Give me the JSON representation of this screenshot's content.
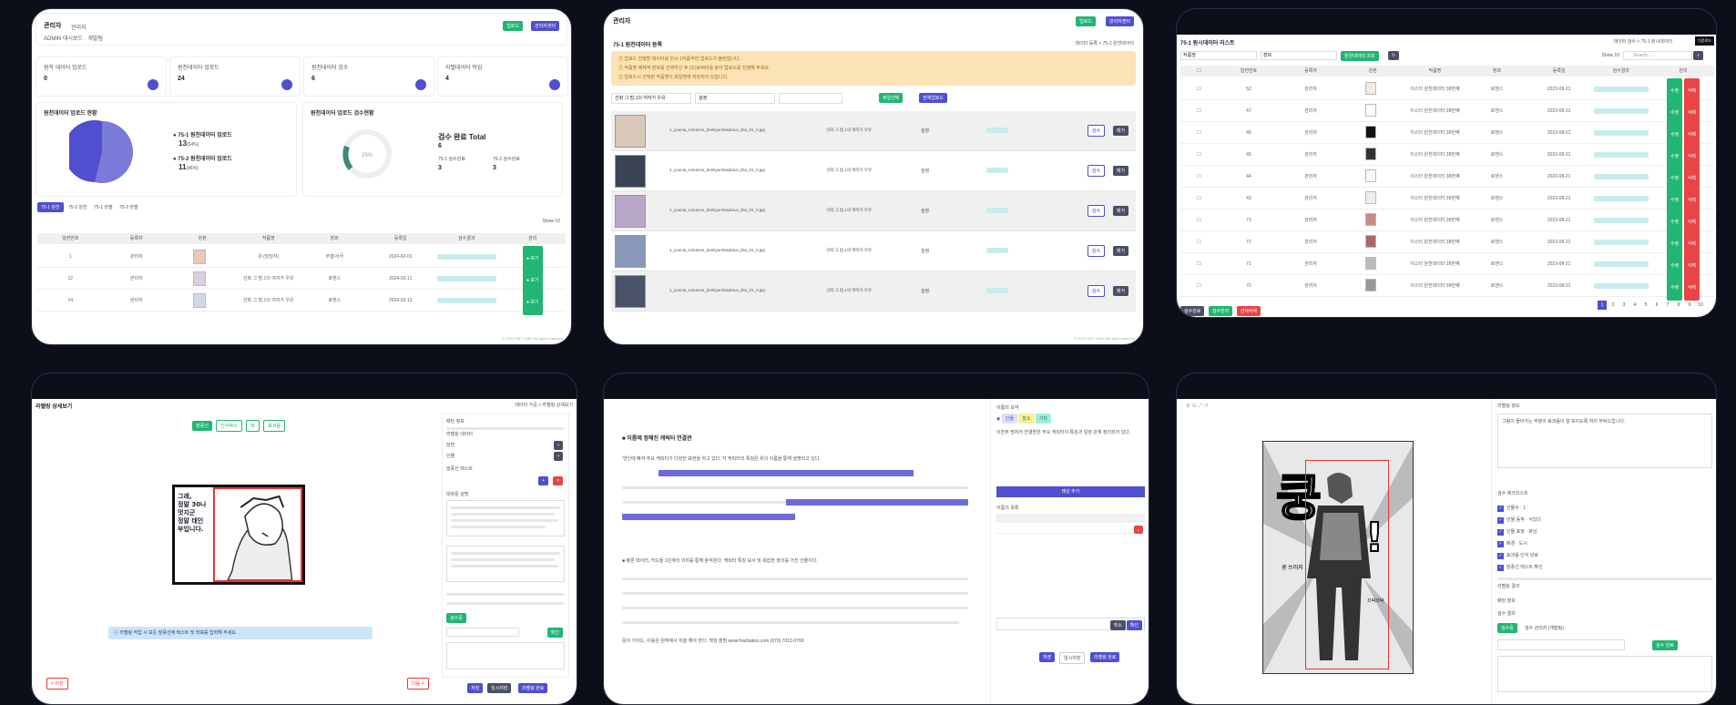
{
  "panel1": {
    "title": "관리자",
    "sub": "관리자",
    "breadcrumb": "ADMIN 대시보드 · 개발팀",
    "btn1": "업로드",
    "btn2": "관리자센터",
    "stats": [
      {
        "label": "원작 데이터 업로드",
        "value": "0"
      },
      {
        "label": "원천데이터 업로드",
        "value": "24"
      },
      {
        "label": "원천데이터 검수",
        "value": "6"
      },
      {
        "label": "라벨데이터 작업",
        "value": "4"
      }
    ],
    "pie_title": "원천데이터 업로드 현황",
    "legend": [
      {
        "name": "75-1 원천데이터 업로드",
        "value": "13",
        "pct": "(54%)"
      },
      {
        "name": "75-2 원천데이터 업로드",
        "value": "11",
        "pct": "(46%)"
      }
    ],
    "gauge_title": "원천데이터 업로드 검수현황",
    "gauge_label": "검수 완료 Total",
    "gauge_value": "6",
    "gauge_pct": "25%",
    "sub_labels": [
      "75-1 검수완료",
      "75-2 검수완료"
    ],
    "sub_values": [
      "3",
      "3"
    ],
    "tabs": [
      "75-1 원천",
      "75-2 원천",
      "75-1 라벨",
      "75-2 라벨"
    ],
    "headers": [
      "일련번호",
      "등록자",
      "원본",
      "작품명",
      "장르",
      "등록일",
      "검수결과",
      "관리"
    ],
    "rows": [
      {
        "no": "1",
        "user": "관리자",
        "title": "유 (담당자)",
        "genre": "무협/사극",
        "date": "2024-02-01"
      },
      {
        "no": "12",
        "user": "관리자",
        "title": "선화 그 밤,1의 여자가 우유",
        "genre": "로맨스",
        "date": "2024-03-11"
      },
      {
        "no": "14",
        "user": "관리자",
        "title": "선화 그 밤,1의 여자가 우유",
        "genre": "로맨스",
        "date": "2024-03-12"
      }
    ],
    "show": "Show 10",
    "footer": "© 2024 SMT LABS All rights reserved."
  },
  "panel2": {
    "title": "관리자",
    "page": "75-1 원천데이터 등록",
    "breadcrumb": "데이터 등록 > 75-1 원천데이터",
    "notes": [
      "⚠ 업로드 진행할 데이터를 단시 1작품씩만 업로드가 불란합니다.",
      "⚠ 작품명 해제적 장르를 선택하신 후 (으)로써비를 놓아 업로드를 진행해 주세요.",
      "⚠ 업로드시 선택된 작품명이 파일명에 저장되어 있습니다."
    ],
    "select1": "선화 그 밤,1의 여자가 우유",
    "select2": "설정",
    "btn_select": "파일선택",
    "btn_all": "전체업로드",
    "filename": "1_yuunia_romance_donkyumtasdious_Eta_01_0.jpg",
    "work": "선화 그 밤,1의 여자가 우유",
    "genre": "설정",
    "edit": "검사",
    "del": "제거",
    "footer": "© 2024 SMT LABS All rights reserved."
  },
  "panel3": {
    "title": "75-1 원시데이터 리스트",
    "breadcrumb": "데이터 검수 > 75-1 원시데이터",
    "filter1": "작품명",
    "filter2": "장르",
    "btn_search": "원천데이터 조회",
    "show": "Show 10",
    "search_ph": "Search...",
    "headers": [
      "",
      "일련번호",
      "등록자",
      "원본",
      "작품명",
      "장르",
      "등록일",
      "검수결과",
      "관리"
    ],
    "rows": [
      {
        "no": "52",
        "user": "관리자",
        "title": "이스터 원천데이터 38번째",
        "genre": "로맨스",
        "date": "2023-08-21"
      },
      {
        "no": "47",
        "user": "관리자",
        "title": "이스터 원천데이터 38번째",
        "genre": "로맨스",
        "date": "2023-08-21"
      },
      {
        "no": "46",
        "user": "관리자",
        "title": "이스터 원천데이터 38번째",
        "genre": "로맨스",
        "date": "2023-08-21"
      },
      {
        "no": "45",
        "user": "관리자",
        "title": "이스터 원천데이터 38번째",
        "genre": "로맨스",
        "date": "2023-08-21"
      },
      {
        "no": "44",
        "user": "관리자",
        "title": "이스터 원천데이터 38번째",
        "genre": "로맨스",
        "date": "2023-08-21"
      },
      {
        "no": "43",
        "user": "관리자",
        "title": "이스터 원천데이터 38번째",
        "genre": "로맨스",
        "date": "2023-08-21"
      },
      {
        "no": "73",
        "user": "관리자",
        "title": "이스터 원천데이터 38번째",
        "genre": "로맨스",
        "date": "2023-08-21"
      },
      {
        "no": "72",
        "user": "관리자",
        "title": "이스터 원천데이터 38번째",
        "genre": "로맨스",
        "date": "2023-08-21"
      },
      {
        "no": "71",
        "user": "관리자",
        "title": "이스터 원천데이터 38번째",
        "genre": "로맨스",
        "date": "2023-08-21"
      },
      {
        "no": "70",
        "user": "관리자",
        "title": "이스터 원천데이터 38번째",
        "genre": "로맨스",
        "date": "2023-08-21"
      }
    ],
    "btn_edit": "수정",
    "btn_del": "삭제",
    "foot_btns": [
      "검수완료",
      "검수반려",
      "선택삭제"
    ],
    "pages": [
      "1",
      "2",
      "3",
      "4",
      "5",
      "6",
      "7",
      "8",
      "9",
      "10"
    ]
  },
  "panel4": {
    "title": "라벨링 상세보기",
    "breadcrumb": "데이터 가공 > 라벨링 상세보기",
    "tools": [
      "말풍선",
      "인식박스",
      "텍",
      "효과음"
    ],
    "bubble": "그래,\n정말 30나\n멋지군\n정말 태인\n부입니다.",
    "notice": "ⓘ 라벨링 작업 시 모든 말풍선에 텍스트 및 좌표를 입력해 주세요.",
    "btn_prev": "< 이전",
    "btn_next": "다음 >",
    "side_items": [
      "패턴 정보",
      "라벨링 데이터",
      "장면",
      "인물",
      "말풍선 텍스트",
      "대화문 설명"
    ],
    "btn_save": "저장",
    "btn_temp": "임시저장",
    "btn_complete": "라벨링 완료"
  },
  "panel5": {
    "head": "■ 이름에 정해진 캐릭터 연결관",
    "para1": "'연인에 빠져 주요 캐릭터가 다양한 표현을 하고 있다. 각 캐릭터의 특징은 위의 이름을 통해 설명되고 있다.",
    "para2": "■ 평론 데이터, 카드들 1단계의 의미를 통해 분석된다. 캐릭터 특징 묘사 및 복잡한 정의를 가진 인물이다.",
    "footer": "문의 가이드, 이용은 원작에서 지을 해야 한다. 책임 출범 www.fourbakso.com (070) 7012-0700",
    "side_title": "이름의 요약",
    "tags": [
      "인물",
      "장소",
      "기타"
    ],
    "side_text": "이번주 명처러 연결받은 주요 캐릭터의 특징과 일정 관계 정리되어 있다.",
    "side_btn": "태깅 추가",
    "tbl_title": "이름의 목록",
    "btn_ok": "확인",
    "btn_cancel": "취소",
    "btn_final": "라벨링 완료"
  },
  "panel6": {
    "side_title": "라벨링 정보",
    "comment": "그림이 들어가는 부분의 효과음이 잘 보이도록 처리 부탁드립니다.",
    "section": "검수 체크리스트",
    "checks": [
      "인물수 · 1",
      "인물 동작 · 서있다",
      "인물 표정 · 화남",
      "배경 · 도시",
      "효과음 인식 완료",
      "말풍선 텍스트 확인"
    ],
    "items": [
      "라벨링 결과",
      "패턴 정보",
      "검수 결과"
    ],
    "status": "검수중",
    "reviewer": "검수 관리자 (개발팀)",
    "btn_review": "검수 완료"
  }
}
